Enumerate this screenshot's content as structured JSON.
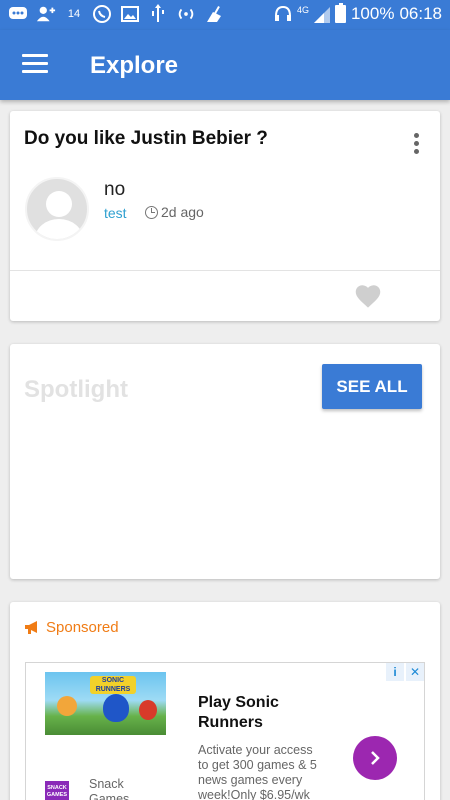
{
  "status_bar": {
    "battery": "100%",
    "time": "06:18",
    "network": "4G",
    "notification_count": "14"
  },
  "app_bar": {
    "title": "Explore"
  },
  "question_card": {
    "question": "Do you like Justin Bebier ?",
    "answer": "no",
    "user": "test",
    "time": "2d ago"
  },
  "spotlight": {
    "title": "Spotlight",
    "button": "SEE ALL"
  },
  "sponsored": {
    "label": "Sponsored",
    "ad": {
      "title": "Play Sonic Runners",
      "description": "Activate your access to get 300 games & 5 news games every week!Only $6.95/wk",
      "brand": "Snack Games",
      "brand_logo_text": "SNACK GAMES",
      "image_logo_text": "SONIC RUNNERS",
      "info_glyph": "i",
      "close_glyph": "✕"
    }
  },
  "colors": {
    "primary": "#3a7bd5",
    "accent_orange": "#f07c15",
    "link": "#2fa0d0",
    "ad_button": "#9c27b0"
  }
}
